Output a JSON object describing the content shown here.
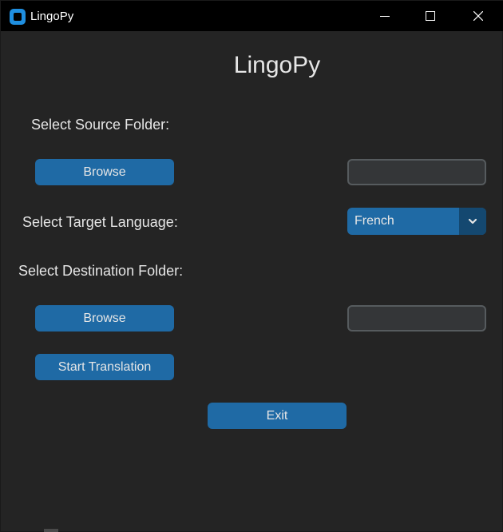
{
  "window": {
    "title": "LingoPy",
    "controls": {
      "minimize": "minimize-icon",
      "maximize": "maximize-icon",
      "close": "close-icon"
    }
  },
  "main": {
    "heading": "LingoPy",
    "source_label": "Select Source Folder:",
    "source_browse_label": "Browse",
    "source_path_value": "",
    "language_label": "Select Target Language:",
    "language_selected": "French",
    "destination_label": "Select Destination Folder:",
    "destination_browse_label": "Browse",
    "destination_path_value": "",
    "start_label": "Start Translation",
    "exit_label": "Exit"
  },
  "colors": {
    "background": "#242424",
    "titlebar": "#000000",
    "button": "#1f6aa5",
    "dropdown_arrow_bg": "#144870",
    "entry_bg": "#343638",
    "entry_border": "#565b5e",
    "text": "#e6e6e6"
  }
}
